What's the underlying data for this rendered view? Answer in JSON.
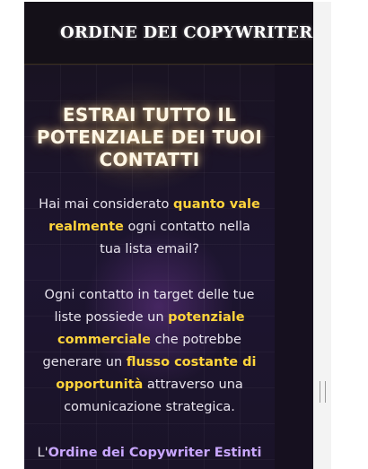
{
  "header": {
    "brand": "ORDINE DEI COPYWRITER ESTINTI"
  },
  "hero": {
    "title_line1": "ESTRAI TUTTO IL",
    "title_line2": "POTENZIALE DEI TUOI",
    "title_line3": "CONTATTI",
    "p1": {
      "part1": "Hai mai considerato ",
      "hl1": "quanto vale realmente",
      "part2": " ogni contatto nella tua lista email?"
    },
    "p2": {
      "part1": "Ogni contatto in target delle tue liste possiede un ",
      "hl1": "potenziale commerciale",
      "part2": " che potrebbe generare un ",
      "hl2": "flusso costante di opportunità",
      "part3": " attraverso una comunicazione strategica."
    },
    "p3": {
      "part1": "L'",
      "hl1": "Ordine dei Copywriter Estinti"
    }
  },
  "colors": {
    "highlight_yellow": "#ffd43b",
    "highlight_purple": "#c9a7ff",
    "background_dark": "#16101f"
  }
}
